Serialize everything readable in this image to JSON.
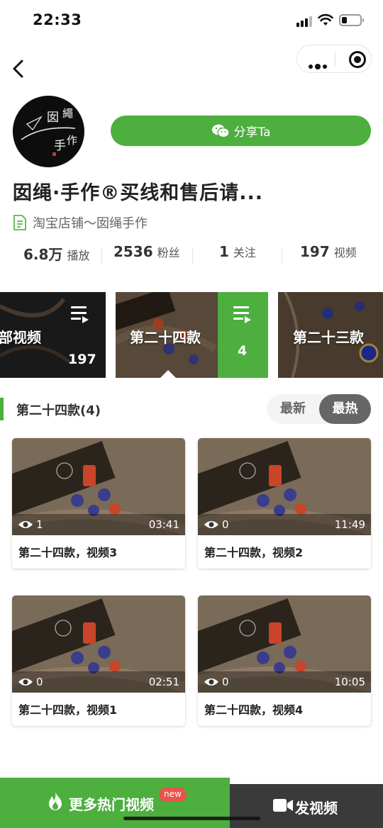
{
  "status_bar": {
    "time": "22:33"
  },
  "profile": {
    "name": "囡绳·手作®买线和售后请...",
    "shop": "淘宝店铺～囡绳手作",
    "share_label": "分享Ta",
    "avatar_text": "囡繩手作"
  },
  "stats": [
    {
      "value": "6.8万",
      "label": "播放"
    },
    {
      "value": "2536",
      "label": "粉丝"
    },
    {
      "value": "1",
      "label": "关注"
    },
    {
      "value": "197",
      "label": "视频"
    }
  ],
  "collections": [
    {
      "title": "部视频",
      "count": "197"
    },
    {
      "title": "第二十四款",
      "count": "4"
    },
    {
      "title": "第二十三款",
      "count": ""
    }
  ],
  "section": {
    "title": "第二十四款(4)",
    "sort_new": "最新",
    "sort_hot": "最热",
    "active_sort": "最热"
  },
  "videos": [
    {
      "title": "第二十四款，视频3",
      "views": "1",
      "duration": "03:41"
    },
    {
      "title": "第二十四款，视频2",
      "views": "0",
      "duration": "11:49"
    },
    {
      "title": "第二十四款，视频1",
      "views": "0",
      "duration": "02:51"
    },
    {
      "title": "第二十四款，视频4",
      "views": "0",
      "duration": "10:05"
    }
  ],
  "bottom": {
    "more_label": "更多热门视频",
    "new_badge": "new",
    "post_label": "发视频"
  },
  "colors": {
    "accent": "#4caf3e",
    "dark": "#3a3a3a",
    "badge": "#e8534a"
  }
}
